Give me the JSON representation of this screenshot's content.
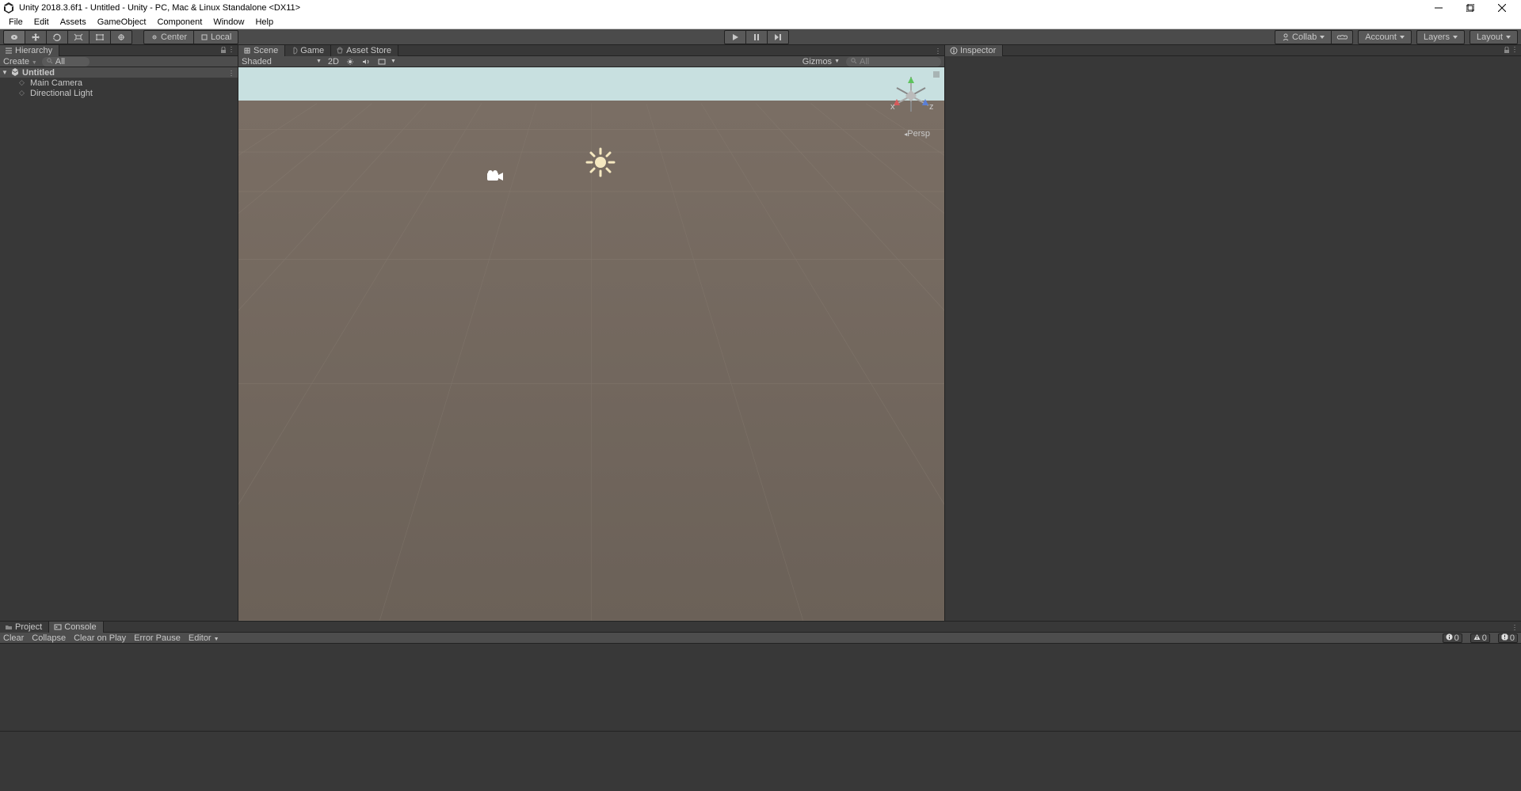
{
  "titlebar": {
    "title": "Unity 2018.3.6f1 - Untitled - Unity - PC, Mac & Linux Standalone <DX11>"
  },
  "menubar": {
    "items": [
      "File",
      "Edit",
      "Assets",
      "GameObject",
      "Component",
      "Window",
      "Help"
    ]
  },
  "toolbar": {
    "pivot_center": "Center",
    "pivot_local": "Local",
    "collab": "Collab",
    "account": "Account",
    "layers": "Layers",
    "layout": "Layout"
  },
  "hierarchy": {
    "tab": "Hierarchy",
    "create": "Create",
    "search_placeholder": "All",
    "scene": "Untitled",
    "items": [
      "Main Camera",
      "Directional Light"
    ]
  },
  "scene_tabs": {
    "scene": "Scene",
    "game": "Game",
    "asset_store": "Asset Store"
  },
  "scene_toolbar": {
    "shading": "Shaded",
    "mode2d": "2D",
    "gizmos": "Gizmos",
    "search_placeholder": "All"
  },
  "scene_view": {
    "persp": "Persp",
    "axis_x": "x",
    "axis_z": "z"
  },
  "inspector": {
    "tab": "Inspector"
  },
  "project_console": {
    "tabs": {
      "project": "Project",
      "console": "Console"
    },
    "buttons": {
      "clear": "Clear",
      "collapse": "Collapse",
      "clear_on_play": "Clear on Play",
      "error_pause": "Error Pause",
      "editor": "Editor"
    },
    "counts": {
      "info": "0",
      "warn": "0",
      "error": "0"
    }
  }
}
